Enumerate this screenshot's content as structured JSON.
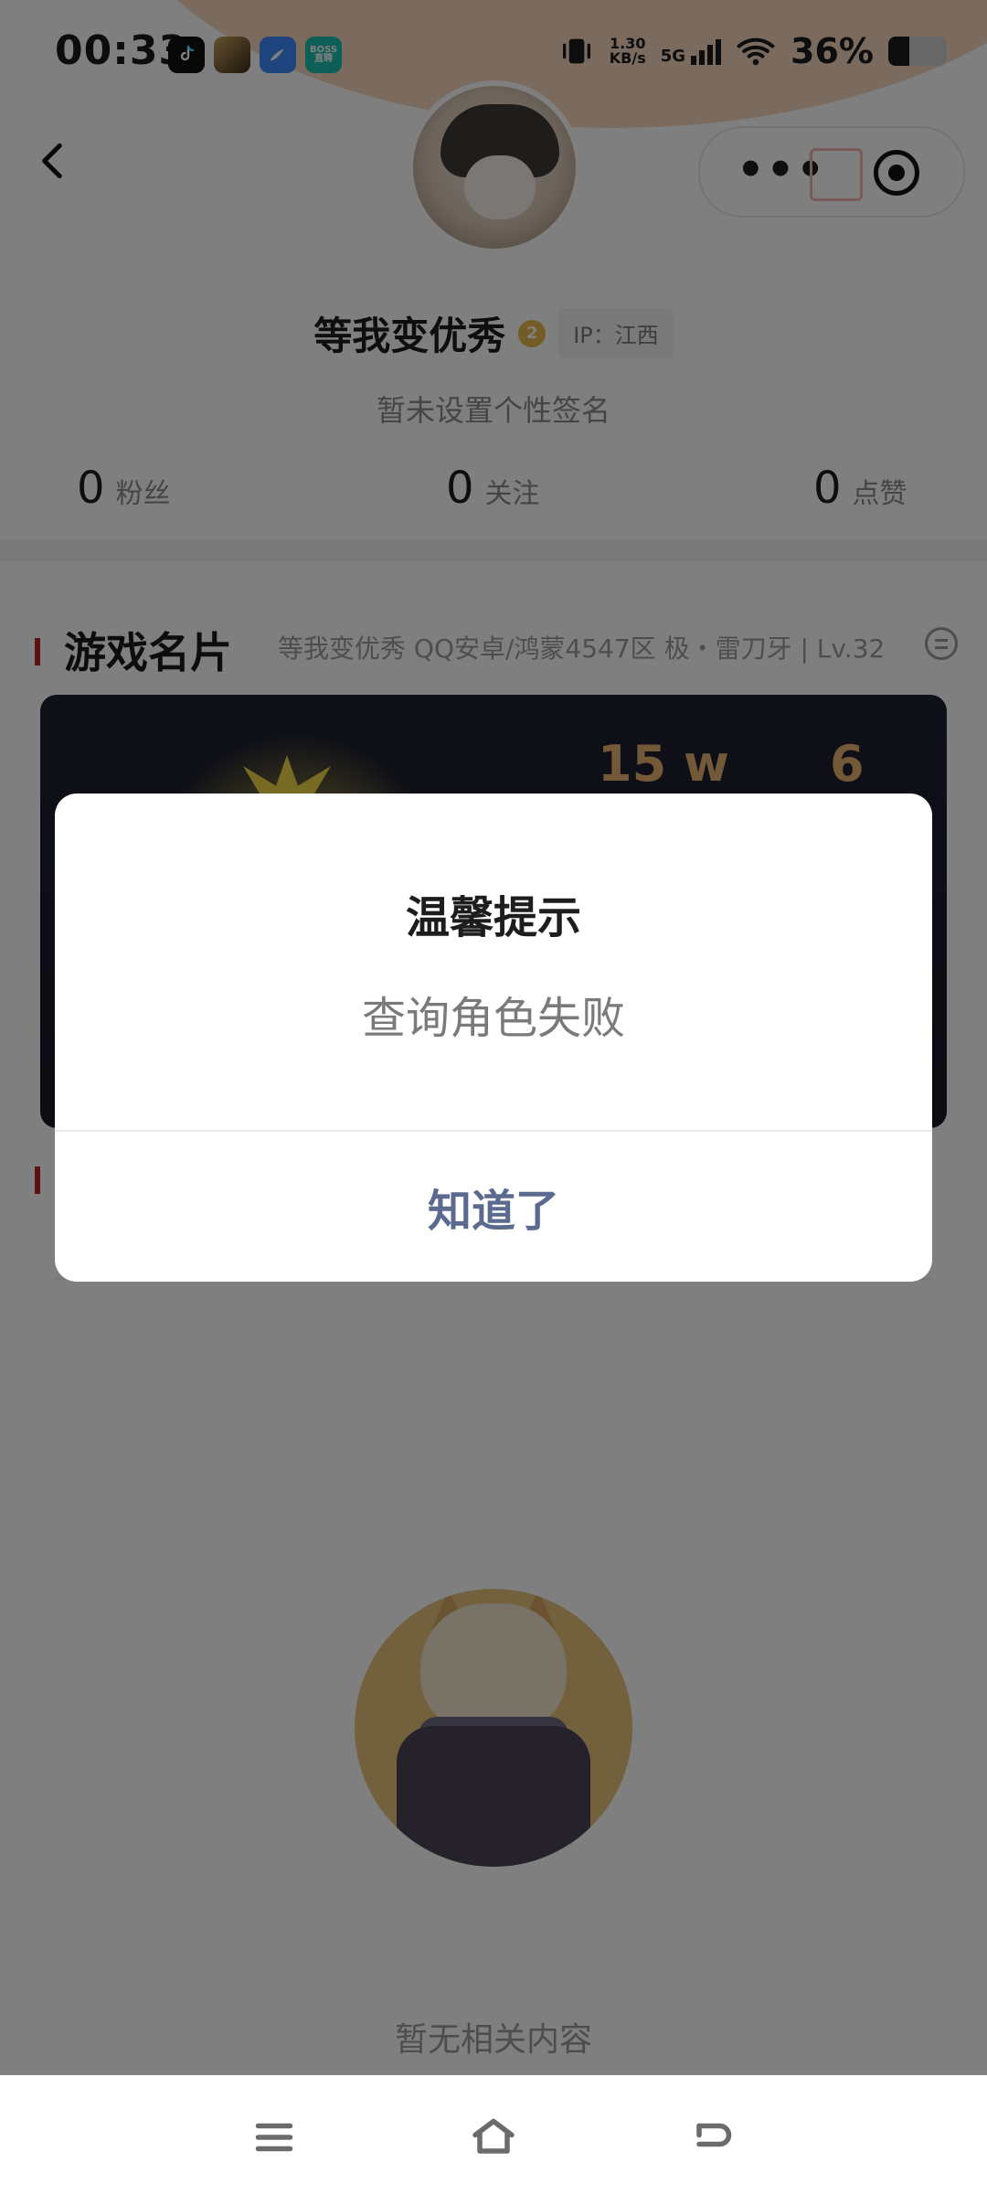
{
  "status_bar": {
    "time": "00:33",
    "app_icons": [
      {
        "name": "tiktok-app-icon",
        "text": ""
      },
      {
        "name": "game-app-icon",
        "text": ""
      },
      {
        "name": "feather-app-icon",
        "text": ""
      },
      {
        "name": "boss-app-icon",
        "text": "BOSS 直聘"
      }
    ],
    "net_speed_value": "1.30",
    "net_speed_unit": "KB/s",
    "network": "5G",
    "battery_percent": "36%",
    "battery_level": 0.36
  },
  "header": {
    "back_icon": "chevron-left-icon",
    "capsule": {
      "more_label": "•••",
      "edit_icon": "edit-icon",
      "record_icon": "record-icon"
    }
  },
  "profile": {
    "nickname": "等我变优秀",
    "level_badge": "2",
    "ip_tag": "IP：江西",
    "signature": "暂未设置个性签名",
    "stats": {
      "fans": {
        "value": "0",
        "label": "粉丝"
      },
      "following": {
        "value": "0",
        "label": "关注"
      },
      "likes": {
        "value": "0",
        "label": "点赞"
      }
    }
  },
  "game_card": {
    "section_title": "游戏名片",
    "meta": "等我变优秀 QQ安卓/鸿蒙4547区 极・雷刀牙 | Lv.32",
    "stat_one": "15 w",
    "stat_two": "6"
  },
  "empty_state": {
    "text": "暂无相关内容"
  },
  "modal": {
    "title": "温馨提示",
    "message": "查询角色失败",
    "button": "知道了"
  },
  "nav": {
    "menu_icon": "menu-icon",
    "home_icon": "home-icon",
    "back_icon": "back-icon"
  }
}
